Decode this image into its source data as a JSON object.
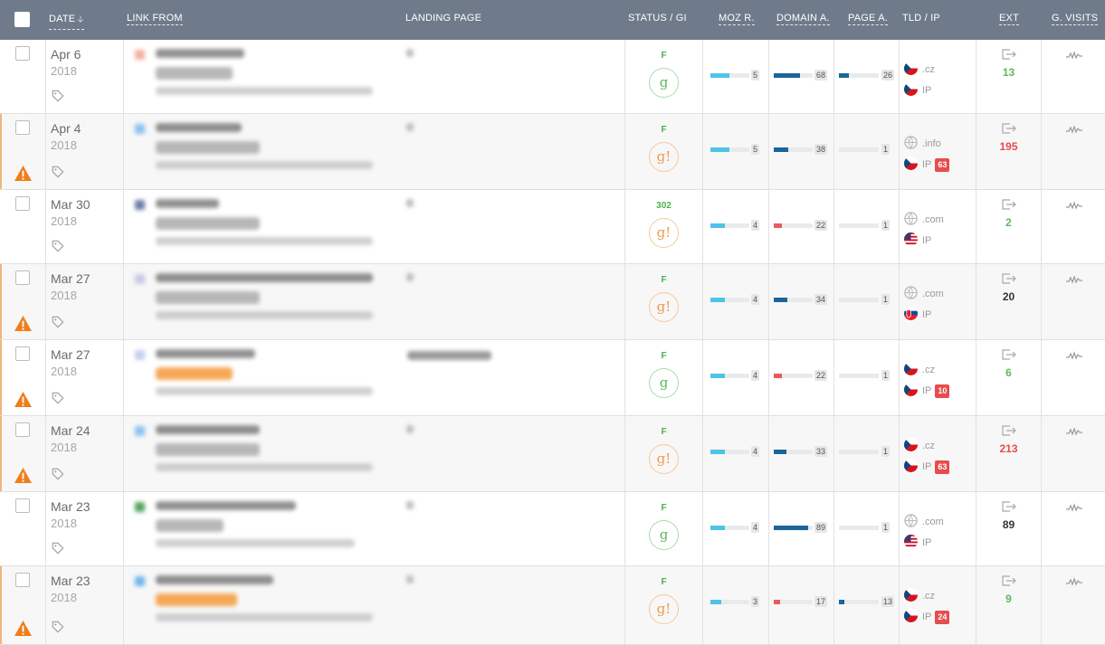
{
  "header": {
    "date": "DATE",
    "link_from": "LINK FROM",
    "landing_page": "LANDING PAGE",
    "status_gi": "STATUS / GI",
    "moz_rank": "MOZ R.",
    "domain_authority": "DOMAIN A.",
    "page_authority": "PAGE A.",
    "tld_ip": "TLD / IP",
    "ext": "EXT",
    "google_visits": "G. VISITS"
  },
  "colors": {
    "header_bg": "#6f7b8b",
    "moz_bar": "#4fc3e8",
    "authority_bar": "#1a6599",
    "authority_low": "#e85b5b",
    "ext_green": "#5cb85c",
    "ext_red": "#e84c4c",
    "ext_dark": "#333333"
  },
  "rows": [
    {
      "date": "Apr 6",
      "year": "2018",
      "warning": false,
      "status": "F",
      "gi": "indexed",
      "moz": "5",
      "moz_pct": 48,
      "da": "68",
      "pa": "26",
      "tld": ".cz",
      "tld_flag": "cz",
      "ip_flag": "cz",
      "ip_label": "IP",
      "ip_count": "",
      "ext": "13",
      "ext_color": "green"
    },
    {
      "date": "Apr 4",
      "year": "2018",
      "warning": true,
      "status": "F",
      "gi": "not-indexed",
      "moz": "5",
      "moz_pct": 48,
      "da": "38",
      "pa": "1",
      "tld": ".info",
      "tld_flag": "globe",
      "ip_flag": "cz",
      "ip_label": "IP",
      "ip_count": "63",
      "ext": "195",
      "ext_color": "red"
    },
    {
      "date": "Mar 30",
      "year": "2018",
      "warning": false,
      "status": "302",
      "gi": "not-indexed",
      "moz": "4",
      "moz_pct": 38,
      "da": "22",
      "pa": "1",
      "tld": ".com",
      "tld_flag": "globe",
      "ip_flag": "us",
      "ip_label": "IP",
      "ip_count": "",
      "ext": "2",
      "ext_color": "green"
    },
    {
      "date": "Mar 27",
      "year": "2018",
      "warning": true,
      "status": "F",
      "gi": "not-indexed",
      "moz": "4",
      "moz_pct": 38,
      "da": "34",
      "pa": "1",
      "tld": ".com",
      "tld_flag": "globe",
      "ip_flag": "sk",
      "ip_label": "IP",
      "ip_count": "",
      "ext": "20",
      "ext_color": "dark"
    },
    {
      "date": "Mar 27",
      "year": "2018",
      "warning": true,
      "status": "F",
      "gi": "indexed",
      "moz": "4",
      "moz_pct": 38,
      "da": "22",
      "pa": "1",
      "tld": ".cz",
      "tld_flag": "cz",
      "ip_flag": "cz",
      "ip_label": "IP",
      "ip_count": "10",
      "ext": "6",
      "ext_color": "green"
    },
    {
      "date": "Mar 24",
      "year": "2018",
      "warning": true,
      "status": "F",
      "gi": "not-indexed",
      "moz": "4",
      "moz_pct": 38,
      "da": "33",
      "pa": "1",
      "tld": ".cz",
      "tld_flag": "cz",
      "ip_flag": "cz",
      "ip_label": "IP",
      "ip_count": "63",
      "ext": "213",
      "ext_color": "red"
    },
    {
      "date": "Mar 23",
      "year": "2018",
      "warning": false,
      "status": "F",
      "gi": "indexed",
      "moz": "4",
      "moz_pct": 38,
      "da": "89",
      "pa": "1",
      "tld": ".com",
      "tld_flag": "globe",
      "ip_flag": "us",
      "ip_label": "IP",
      "ip_count": "",
      "ext": "89",
      "ext_color": "dark"
    },
    {
      "date": "Mar 23",
      "year": "2018",
      "warning": true,
      "status": "F",
      "gi": "not-indexed",
      "moz": "3",
      "moz_pct": 28,
      "da": "17",
      "pa": "13",
      "tld": ".cz",
      "tld_flag": "cz",
      "ip_flag": "cz",
      "ip_label": "IP",
      "ip_count": "24",
      "ext": "9",
      "ext_color": "green"
    }
  ]
}
